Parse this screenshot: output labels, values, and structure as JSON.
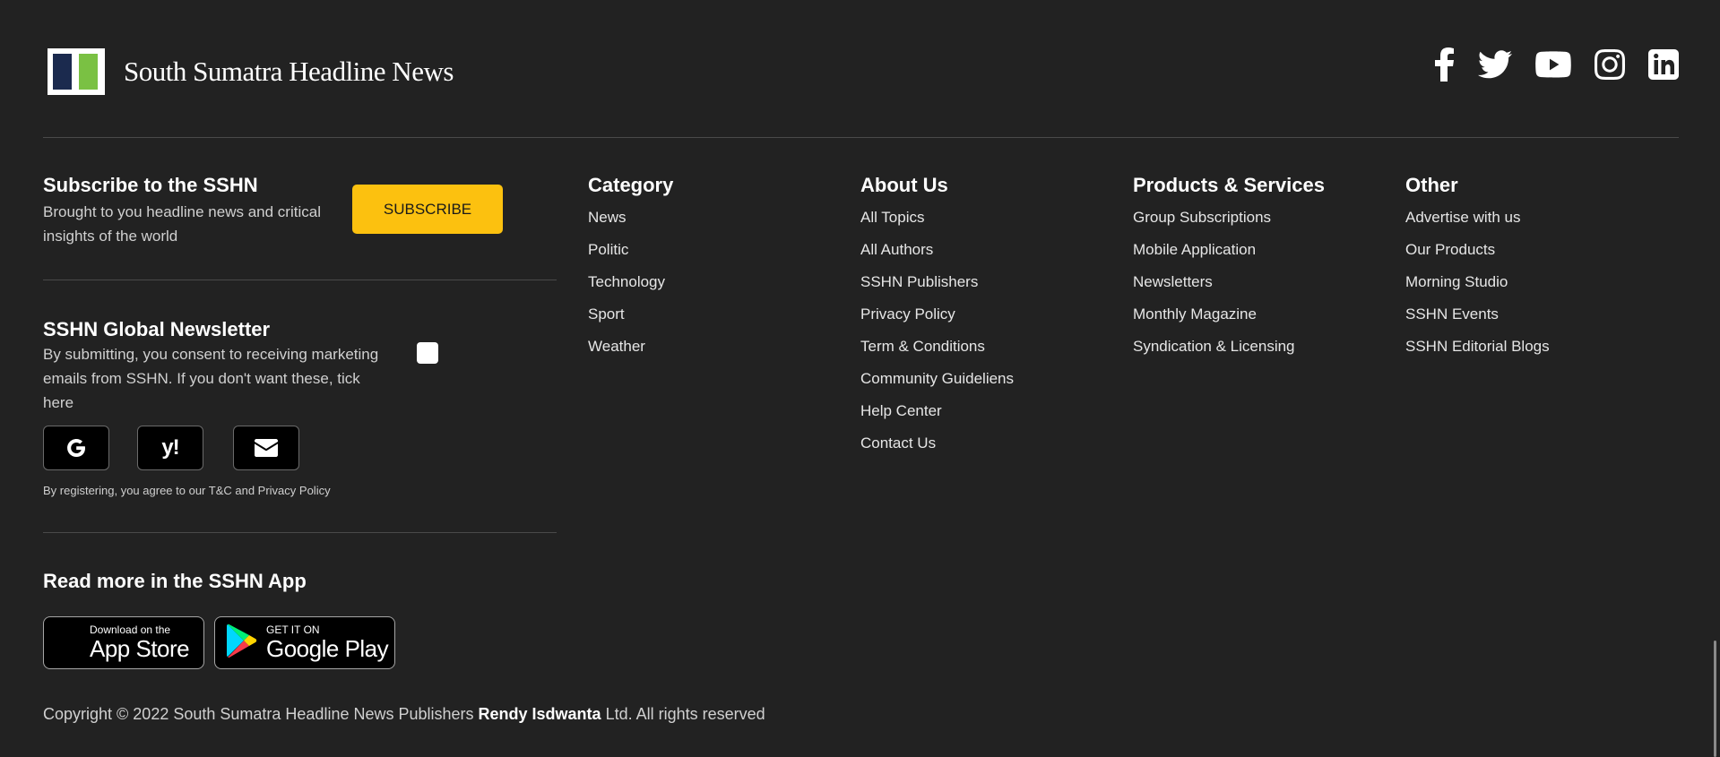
{
  "brand": {
    "name": "South Sumatra Headline News",
    "logo_colors": [
      "#1b2a4e",
      "#7ac143"
    ]
  },
  "socials": [
    {
      "name": "facebook-icon"
    },
    {
      "name": "twitter-icon"
    },
    {
      "name": "youtube-icon"
    },
    {
      "name": "instagram-icon"
    },
    {
      "name": "linkedin-icon"
    }
  ],
  "subscribe": {
    "title": "Subscribe to the SSHN",
    "description": "Brought to you headline news and critical insights of the world",
    "button_label": "SUBSCRIBE",
    "button_color": "#fcc10f"
  },
  "newsletter": {
    "title": "SSHN Global Newsletter",
    "description": "By submitting, you consent to receiving marketing emails from SSHN. If you don't want these, tick here",
    "login_options": [
      "google-icon",
      "yahoo-icon",
      "mail-icon"
    ],
    "yahoo_glyph": "y!",
    "legal": "By registering, you agree to our T&C and Privacy Policy"
  },
  "app": {
    "title": "Read more in the SSHN App",
    "app_store": {
      "small": "Download on the",
      "big": "App Store"
    },
    "google_play": {
      "small": "GET IT ON",
      "big": "Google Play"
    }
  },
  "columns": {
    "category": {
      "title": "Category",
      "items": [
        "News",
        "Politic",
        "Technology",
        "Sport",
        "Weather"
      ]
    },
    "about": {
      "title": "About Us",
      "items": [
        "All Topics",
        "All Authors",
        "SSHN Publishers",
        "Privacy Policy",
        "Term & Conditions",
        "Community Guideliens",
        "Help Center",
        "Contact Us"
      ]
    },
    "products": {
      "title": "Products & Services",
      "items": [
        "Group Subscriptions",
        "Mobile Application",
        "Newsletters",
        "Monthly Magazine",
        "Syndication & Licensing"
      ]
    },
    "other": {
      "title": "Other",
      "items": [
        "Advertise with us",
        "Our Products",
        "Morning Studio",
        "SSHN Events",
        "SSHN Editorial Blogs"
      ]
    }
  },
  "copyright": {
    "prefix": "Copyright © 2022 South Sumatra Headline News Publishers ",
    "bold": "Rendy Isdwanta",
    "suffix": " Ltd. All rights reserved"
  }
}
